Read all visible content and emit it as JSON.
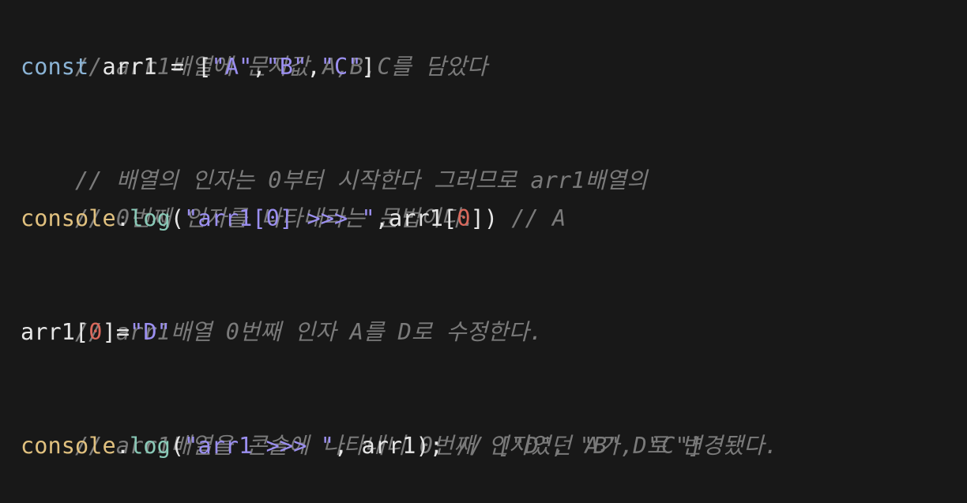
{
  "code": {
    "l1": {
      "comment": "// arr1배열에 문자값 A,B,C를 담았다"
    },
    "l2": {
      "keyword": "const",
      "t1": " arr1 = [",
      "s1": "\"A\"",
      "c1": ",",
      "s2": "\"B\"",
      "c2": ",",
      "s3": "\"C\"",
      "close": "]"
    },
    "l3": {
      "comment": "// 배열의 인자는 0부터 시작한다 그러므로 arr1배열의"
    },
    "l4": {
      "comment": "// 0번째 인자를 나타내라는 문법이다."
    },
    "l5": {
      "obj": "console",
      "dot": ".",
      "method": "log",
      "open": "(",
      "str": "\"arr1[0] >>> \"",
      "t1": ",arr1[",
      "num": "0",
      "t2": "]) ",
      "comment": "// A"
    },
    "l6": {
      "comment": "// arr1배열 0번째 인자 A를 D로 수정한다."
    },
    "l7": {
      "t1": "arr1[",
      "num": "0",
      "t2": "]=",
      "str": "\"D\""
    },
    "l8": {
      "comment": "// arr1배열을 콘솔에 나타내니 0번째 인자였던 A가 D로 변경됐다."
    },
    "l9": {
      "obj": "console",
      "dot": ".",
      "method": "log",
      "open": "(",
      "str": "\"arr1 >>> \"",
      "t1": ", arr1); ",
      "comment": "// [\"D\", \"B\", \"C\"]"
    }
  },
  "colors": {
    "background": "#181818",
    "comment": "#7a7a7a",
    "keyword": "#8bb4d6",
    "function": "#e1c17f",
    "method": "#89c9b7",
    "string": "#9b8ff0",
    "number": "#d9685c",
    "text": "#e6e6e6"
  }
}
